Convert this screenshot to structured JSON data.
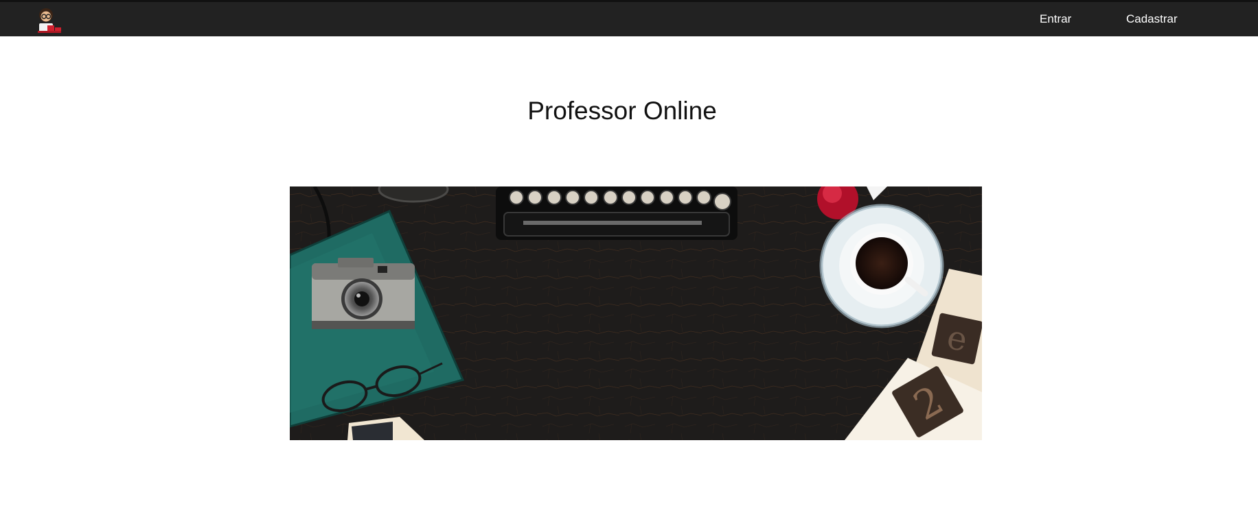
{
  "navbar": {
    "logo_icon": "teacher-avatar-icon",
    "links": [
      {
        "label": "Entrar"
      },
      {
        "label": "Cadastrar"
      }
    ]
  },
  "main": {
    "title": "Professor Online",
    "hero_image": {
      "description_icon": "desk-flatlay-image",
      "colors": {
        "table": "#1e1c1b",
        "notebook": "#1f6b63",
        "rose": "#b1102a"
      }
    }
  }
}
